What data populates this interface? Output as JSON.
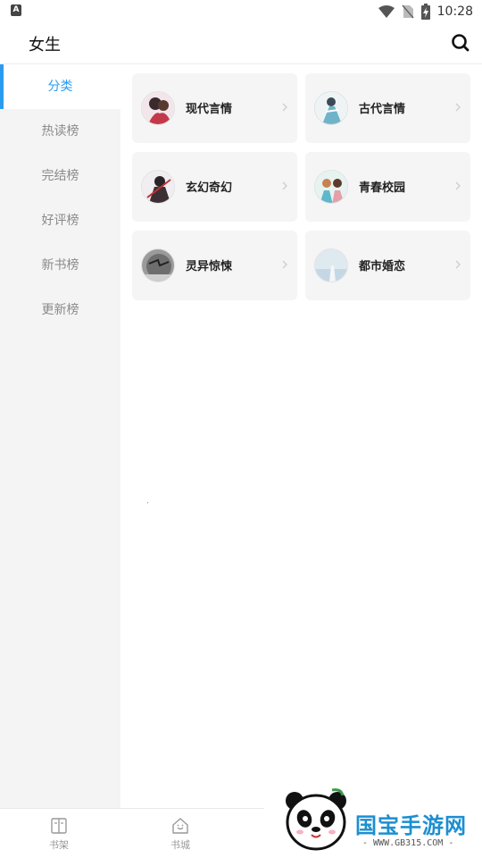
{
  "status_bar": {
    "time": "10:28",
    "icons": [
      "wifi-icon",
      "no-sim-icon",
      "battery-charging-icon"
    ]
  },
  "header": {
    "title": "女生",
    "search_icon": "search-icon"
  },
  "sidebar": {
    "items": [
      {
        "label": "分类",
        "active": true
      },
      {
        "label": "热读榜",
        "active": false
      },
      {
        "label": "完结榜",
        "active": false
      },
      {
        "label": "好评榜",
        "active": false
      },
      {
        "label": "新书榜",
        "active": false
      },
      {
        "label": "更新榜",
        "active": false
      }
    ]
  },
  "categories": [
    {
      "label": "现代言情",
      "icon": "modern-romance-avatar"
    },
    {
      "label": "古代言情",
      "icon": "ancient-romance-avatar"
    },
    {
      "label": "玄幻奇幻",
      "icon": "fantasy-avatar"
    },
    {
      "label": "青春校园",
      "icon": "campus-avatar"
    },
    {
      "label": "灵异惊悚",
      "icon": "thriller-avatar"
    },
    {
      "label": "都市婚恋",
      "icon": "urban-marriage-avatar"
    }
  ],
  "bottom_nav": {
    "items": [
      {
        "label": "书架",
        "icon": "book-open-icon"
      },
      {
        "label": "书城",
        "icon": "store-icon"
      }
    ]
  },
  "watermark": {
    "brand": "国宝手游网",
    "url": "- WWW.GB315.COM -"
  },
  "colors": {
    "accent": "#2a9cf0",
    "sidebar_bg": "#f4f4f4",
    "card_bg": "#f5f5f5"
  }
}
